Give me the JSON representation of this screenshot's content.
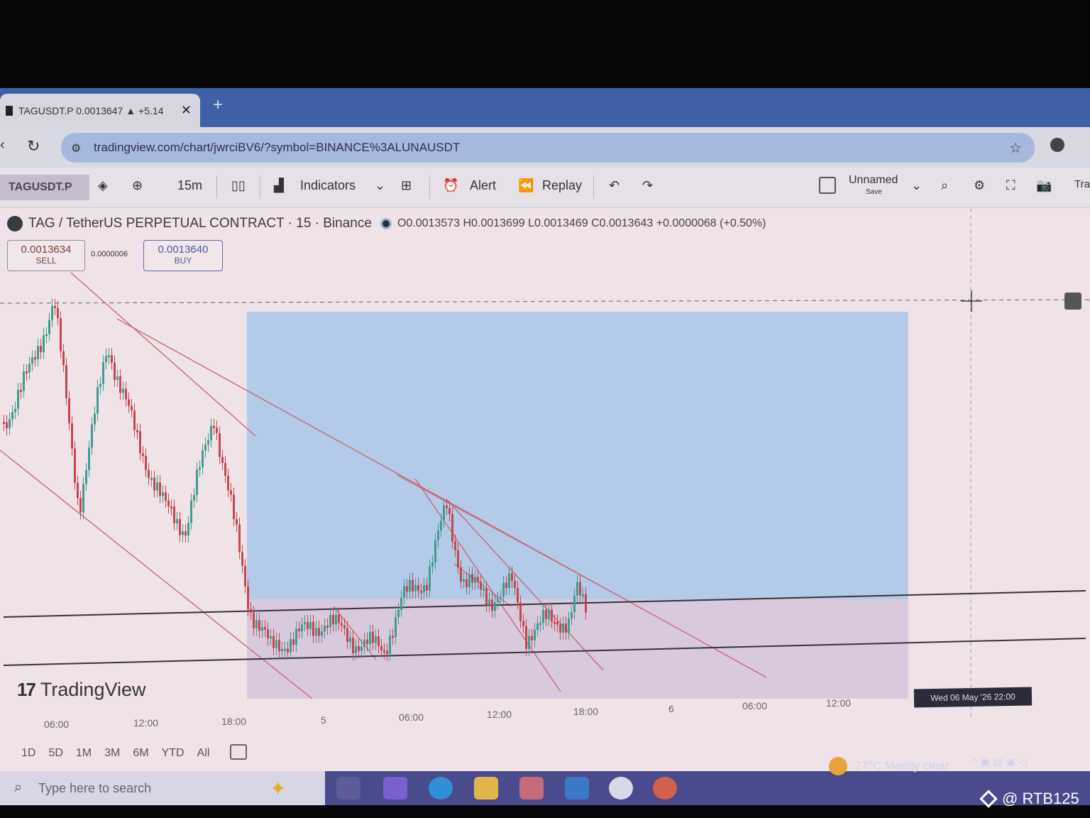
{
  "browser": {
    "tab_title": "TAGUSDT.P 0.0013647 ▲ +5.14",
    "tab_close": "✕",
    "new_tab": "+",
    "url": "tradingview.com/chart/jwrciBV6/?symbol=BINANCE%3ALUNAUSDT"
  },
  "toolbar": {
    "symbol": "TAGUSDT.P",
    "interval": "15m",
    "indicators": "Indicators",
    "alert": "Alert",
    "replay": "Replay",
    "layout_name": "Unnamed",
    "layout_sub": "Save",
    "trade": "Tra"
  },
  "legend": {
    "title": "TAG / TetherUS PERPETUAL CONTRACT · 15 · Binance",
    "ohlc": "O0.0013573 H0.0013699 L0.0013469 C0.0013643 +0.0000068 (+0.50%)"
  },
  "quote": {
    "sell_price": "0.0013634",
    "sell_label": "SELL",
    "spread": "0.0000006",
    "buy_price": "0.0013640",
    "buy_label": "BUY"
  },
  "brand": "TradingView",
  "time_axis": [
    "06:00",
    "12:00",
    "18:00",
    "5",
    "06:00",
    "12:00",
    "18:00",
    "6",
    "06:00",
    "12:00"
  ],
  "crosshair_date": "Wed 06 May '26  22:00",
  "ranges": [
    "1D",
    "5D",
    "1M",
    "3M",
    "6M",
    "YTD",
    "All"
  ],
  "taskbar": {
    "search_placeholder": "Type here to search",
    "weather": "27°C  Mostly clear"
  },
  "watermark": "@ RTB125",
  "colors": {
    "up_candle": "#3f9c8f",
    "down_candle": "#c8454e",
    "trendline": "#c86a7a",
    "horizontal_line": "#333340",
    "highlight_box": "#9fc3e8",
    "taskbar": "#4a4b8c"
  }
}
